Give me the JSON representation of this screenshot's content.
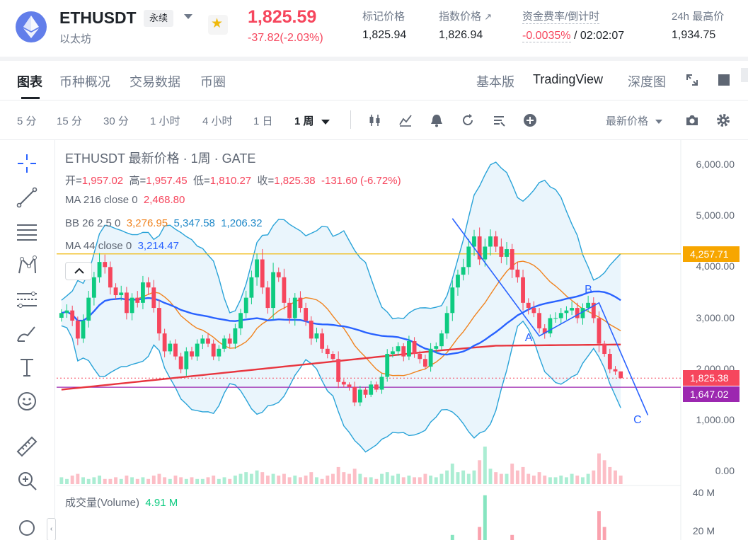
{
  "header": {
    "symbol": "ETHUSDT",
    "contract_type": "永续",
    "cn_name": "以太坊",
    "last_price": "1,825.59",
    "change": "-37.82(-2.03%)",
    "mark_price_label": "标记价格",
    "mark_price": "1,825.94",
    "index_price_label": "指数价格",
    "index_price": "1,826.94",
    "funding_label": "资金费率/倒计时",
    "funding_rate": "-0.0035%",
    "countdown": "/ 02:02:07",
    "high_24h_label": "24h 最高价",
    "high_24h": "1,934.75"
  },
  "tabs": [
    "图表",
    "币种概况",
    "交易数据",
    "币圈"
  ],
  "views": [
    "基本版",
    "TradingView",
    "深度图"
  ],
  "intervals": [
    "5 分",
    "15 分",
    "30 分",
    "1 小时",
    "4 小时",
    "1 日",
    "1 周"
  ],
  "price_type": "最新价格",
  "legend": {
    "title": "ETHUSDT 最新价格 · 1周 · GATE",
    "ohlc": {
      "open_label": "开=",
      "open": "1,957.02",
      "high_label": "高=",
      "high": "1,957.45",
      "low_label": "低=",
      "low": "1,810.27",
      "close_label": "收=",
      "close": "1,825.38",
      "change": "-131.60 (-6.72%)"
    },
    "ma216": {
      "label": "MA 216 close 0",
      "value": "2,468.80"
    },
    "bb": {
      "label": "BB 26 2.5 0",
      "basis": "3,276.95",
      "upper": "5,347.58",
      "lower": "1,206.32"
    },
    "ma44": {
      "label": "MA 44 close 0",
      "value": "3,214.47"
    },
    "volume": {
      "label": "成交量(Volume)",
      "value": "4.91 M"
    }
  },
  "colors": {
    "up": "#0ecb81",
    "down": "#f6465d",
    "ma216": "#e8353e",
    "ma44": "#2962ff",
    "bb_basis": "#f0831f",
    "bb_band": "#29a3d8",
    "drawing": "#2962ff",
    "hline_yellow": "#f0b90b",
    "hline_purple": "#9c27b0",
    "tag_current": "#f6465d"
  },
  "chart_data": {
    "type": "candlestick",
    "interval": "1 周",
    "exchange": "GATE",
    "ylim": [
      0,
      6500
    ],
    "y_ticks": [
      "6,000.00",
      "5,000.00",
      "4,000.00",
      "3,000.00",
      "2,000.00",
      "1,000.00",
      "0.00"
    ],
    "y_tick_values": [
      6000,
      5000,
      4000,
      3000,
      2000,
      1000,
      0
    ],
    "volume_ticks": [
      "40 M",
      "20 M"
    ],
    "horizontal_levels": [
      {
        "price": 4257.71,
        "label": "4,257.71",
        "color": "#f0b90b"
      },
      {
        "price": 1647.02,
        "label": "1,647.02",
        "color": "#9c27b0"
      }
    ],
    "current_price": {
      "price": 1825.38,
      "label": "1,825.38"
    },
    "wave_labels": [
      {
        "text": "A",
        "candle_index": 86,
        "price": 2600
      },
      {
        "text": "B",
        "candle_index": 97,
        "price": 3550
      },
      {
        "text": "C",
        "candle_index": 106,
        "price": 1000
      }
    ],
    "wave_path": [
      {
        "candle_index": 72,
        "price": 4950
      },
      {
        "candle_index": 88,
        "price": 2650
      },
      {
        "candle_index": 99,
        "price": 3300
      },
      {
        "candle_index": 108,
        "price": 1100
      }
    ],
    "close": [
      3100,
      3150,
      2950,
      2600,
      2950,
      3400,
      3800,
      4100,
      4000,
      3600,
      3450,
      3500,
      3100,
      3400,
      3300,
      3700,
      3600,
      3200,
      2700,
      2350,
      2500,
      2250,
      2000,
      2350,
      2250,
      2500,
      2600,
      2500,
      2250,
      2400,
      2600,
      2500,
      2800,
      3100,
      3400,
      3800,
      4150,
      3600,
      3200,
      3900,
      3800,
      3300,
      3000,
      3400,
      3200,
      2950,
      2600,
      2700,
      2400,
      2300,
      2200,
      1750,
      1700,
      1650,
      1350,
      1600,
      1500,
      1700,
      1600,
      1850,
      2300,
      2350,
      2450,
      2250,
      2550,
      2300,
      2200,
      2050,
      2400,
      2450,
      2700,
      3100,
      3600,
      3850,
      4000,
      4400,
      4600,
      4150,
      4400,
      4600,
      4400,
      4200,
      4350,
      3950,
      3800,
      3300,
      3200,
      3100,
      2800,
      2700,
      3000,
      3000,
      3100,
      3150,
      3200,
      3000,
      3200,
      3300,
      3000,
      2500,
      2300,
      2000,
      1957,
      1825.38
    ],
    "volume": [
      4,
      3,
      5,
      6,
      4,
      3,
      4,
      5,
      3,
      3,
      4,
      3,
      5,
      4,
      3,
      4,
      3,
      5,
      6,
      4,
      3,
      5,
      4,
      3,
      4,
      3,
      3,
      4,
      5,
      3,
      4,
      3,
      5,
      6,
      7,
      6,
      8,
      7,
      5,
      6,
      5,
      6,
      4,
      5,
      4,
      5,
      7,
      4,
      3,
      5,
      6,
      10,
      7,
      6,
      9,
      6,
      4,
      4,
      3,
      6,
      7,
      5,
      6,
      4,
      5,
      4,
      4,
      6,
      5,
      4,
      6,
      8,
      12,
      7,
      8,
      6,
      8,
      14,
      22,
      9,
      7,
      6,
      6,
      12,
      8,
      10,
      6,
      5,
      7,
      5,
      4,
      4,
      5,
      4,
      6,
      5,
      4,
      6,
      8,
      18,
      14,
      10,
      8,
      5
    ]
  }
}
